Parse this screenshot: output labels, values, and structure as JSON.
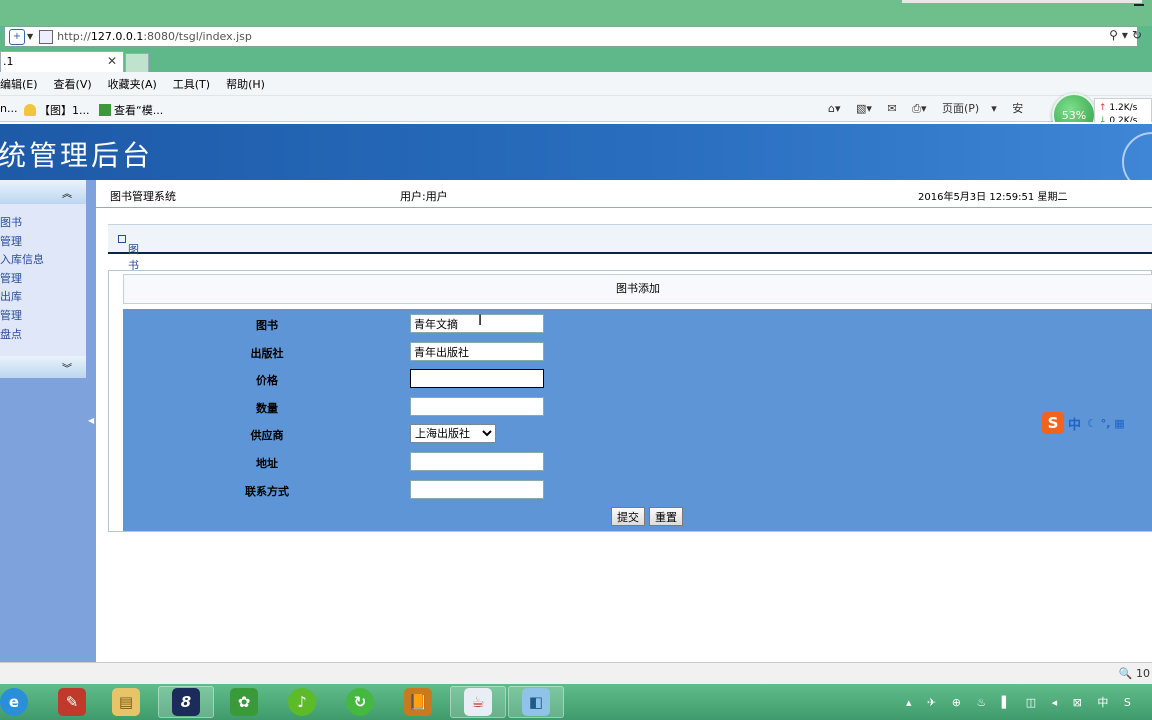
{
  "browser": {
    "url_prefix": "http://",
    "url_host": "127.0.0.1",
    "url_rest": ":8080/tsgl/index.jsp",
    "tab_title": ".1",
    "menu": [
      "编辑(E)",
      "查看(V)",
      "收藏夹(A)",
      "工具(T)",
      "帮助(H)"
    ],
    "favorites": [
      "n...",
      "【图】1...",
      "查看“模..."
    ],
    "commands": [
      "页面(P)",
      "安"
    ],
    "speed": {
      "percent": "53%",
      "up": "1.2K/s",
      "down": "0.2K/s"
    },
    "zoom": "10"
  },
  "site": {
    "banner_title": "统管理后台",
    "system_name": "图书管理系统",
    "user": "用户:用户",
    "datetime": "2016年5月3日  12:59:51  星期二"
  },
  "sidebar": {
    "items": [
      "图书",
      "管理",
      "入库信息",
      "管理",
      "出库",
      "管理",
      "盘点"
    ]
  },
  "section": {
    "title": "图书添加"
  },
  "form": {
    "caption": "图书添加",
    "fields": {
      "book": {
        "label": "图书",
        "value": "青年文摘"
      },
      "publisher": {
        "label": "出版社",
        "value": "青年出版社"
      },
      "price": {
        "label": "价格",
        "value": ""
      },
      "quantity": {
        "label": "数量",
        "value": ""
      },
      "supplier": {
        "label": "供应商",
        "selected": "上海出版社"
      },
      "address": {
        "label": "地址",
        "value": ""
      },
      "contact": {
        "label": "联系方式",
        "value": ""
      }
    },
    "submit_label": "提交",
    "reset_label": "重置"
  },
  "ime": {
    "logo": "S",
    "mode": "中",
    "extras": "☾ °, ▦"
  },
  "taskbar": {
    "apps": [
      "e",
      "✎",
      "▤",
      "8",
      "✿",
      "♪",
      "↻",
      "📙",
      "☕",
      "◧"
    ],
    "tray": "▴ ✈ ⊕ ♨ ▌ ◫ ◂ ⊠ 中 S"
  }
}
